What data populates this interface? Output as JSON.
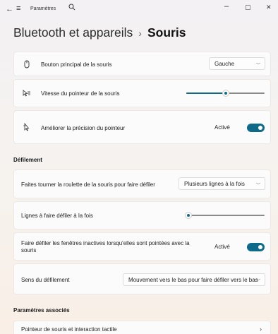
{
  "titlebar": {
    "app_title": "Paramètres",
    "back_glyph": "←",
    "menu_glyph": "≡",
    "minimize_glyph": "–",
    "maximize_glyph": "▢",
    "close_glyph": "✕"
  },
  "breadcrumb": {
    "parent": "Bluetooth et appareils",
    "separator": "›",
    "current": "Souris"
  },
  "settings": {
    "primary_button": {
      "label": "Bouton principal de la souris",
      "value": "Gauche",
      "icon": "mouse-icon"
    },
    "pointer_speed": {
      "label": "Vitesse du pointeur de la souris",
      "level": 0.5,
      "icon": "pointer-speed-icon"
    },
    "pointer_precision": {
      "label": "Améliorer la précision du pointeur",
      "state": "Activé",
      "on": true,
      "icon": "pointer-precision-icon"
    }
  },
  "scrolling": {
    "section_title": "Défilement",
    "wheel": {
      "label": "Faites tourner la roulette de la souris pour faire défiler",
      "value": "Plusieurs lignes à la fois"
    },
    "lines": {
      "label": "Lignes à faire défiler à la fois",
      "level": 0.03
    },
    "inactive": {
      "label_line1": "Faire défiler les fenêtres inactives lorsqu'elles sont pointées avec la",
      "label_line2": "souris",
      "state": "Activé",
      "on": true
    },
    "direction": {
      "label": "Sens du défilement",
      "value": "Mouvement vers le bas pour faire défiler vers le bas"
    }
  },
  "related": {
    "section_title": "Paramètres associés",
    "pointer_link": "Pointeur de souris et interaction tactile"
  },
  "colors": {
    "accent": "#0f6a8a",
    "card": "#fbfbfb"
  }
}
